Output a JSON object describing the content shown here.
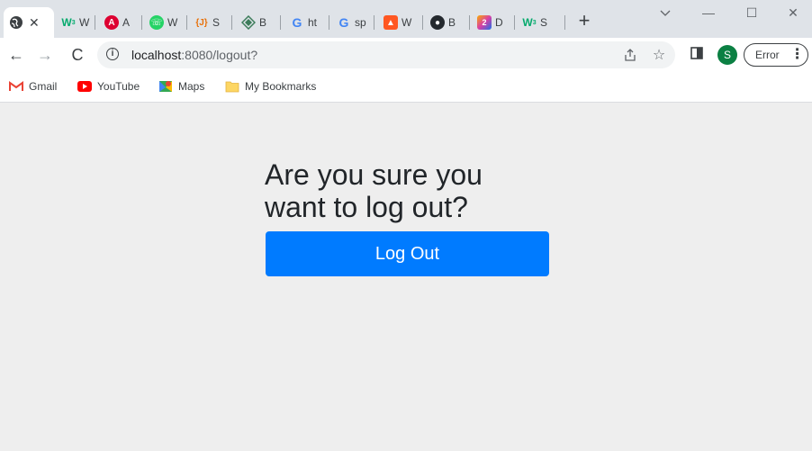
{
  "browser": {
    "tabs": [
      {
        "favicon": "globe-icon",
        "title": "",
        "active": true,
        "color": "#3c4043"
      },
      {
        "favicon": "w3schools-icon",
        "title": "W",
        "color": "#04aa6d"
      },
      {
        "favicon": "angular-icon",
        "title": "A",
        "color": "#dd0031"
      },
      {
        "favicon": "whatsapp-icon",
        "title": "W",
        "color": "#25d366"
      },
      {
        "favicon": "jsonplaceholder-icon",
        "title": "S",
        "color": "#e8710a"
      },
      {
        "favicon": "diamond-icon",
        "title": "B",
        "color": "#3c7c5a"
      },
      {
        "favicon": "google-icon",
        "title": "ht",
        "color": "#4285f4"
      },
      {
        "favicon": "google-icon",
        "title": "sp",
        "color": "#4285f4"
      },
      {
        "favicon": "vercel-icon",
        "title": "W",
        "color": "#ff5722"
      },
      {
        "favicon": "github-icon",
        "title": "B",
        "color": "#24292e"
      },
      {
        "favicon": "app-icon",
        "title": "D",
        "color": "#d93ea6"
      },
      {
        "favicon": "w3schools-icon",
        "title": "S",
        "color": "#04aa6d"
      }
    ],
    "address": {
      "host": "localhost",
      "path": ":8080/logout?"
    },
    "profile_initial": "S",
    "error_label": "Error",
    "bookmarks": [
      {
        "label": "Gmail",
        "icon": "gmail-icon"
      },
      {
        "label": "YouTube",
        "icon": "youtube-icon"
      },
      {
        "label": "Maps",
        "icon": "maps-icon"
      },
      {
        "label": "My Bookmarks",
        "icon": "folder-icon"
      }
    ]
  },
  "page": {
    "heading": "Are you sure you want to log out?",
    "logout_button": "Log Out",
    "button_color": "#007bff"
  }
}
